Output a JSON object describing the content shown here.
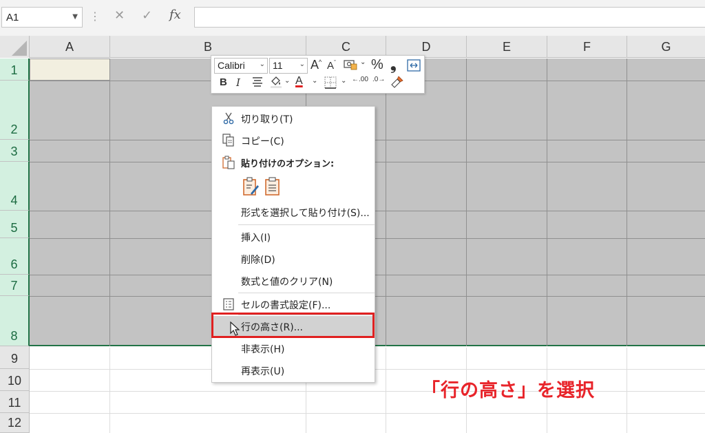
{
  "formula_bar": {
    "name_box": "A1",
    "cancel_icon": "✕",
    "enter_icon": "✓",
    "fx_label": "fx",
    "formula": ""
  },
  "columns": [
    "A",
    "B",
    "C",
    "D",
    "E",
    "F",
    "G"
  ],
  "rows": [
    "1",
    "2",
    "3",
    "4",
    "5",
    "6",
    "7",
    "8",
    "9",
    "10",
    "11",
    "12"
  ],
  "mini_toolbar": {
    "font_name": "Calibri",
    "font_size": "11",
    "increase_font": "A",
    "decrease_font": "A",
    "percent": "%",
    "comma": "❟",
    "bold": "B",
    "italic": "I",
    "font_color_label": "A",
    "increase_decimal": ".00",
    "decrease_decimal": ".0"
  },
  "context_menu": {
    "items": [
      {
        "label": "切り取り(T)",
        "icon": "scissors-icon"
      },
      {
        "label": "コピー(C)",
        "icon": "copy-icon"
      },
      {
        "label": "貼り付けのオプション:",
        "icon": "paste-icon"
      },
      {
        "label": "形式を選択して貼り付け(S)..."
      },
      {
        "label": "挿入(I)"
      },
      {
        "label": "削除(D)"
      },
      {
        "label": "数式と値のクリア(N)"
      },
      {
        "label": "セルの書式設定(F)...",
        "icon": "format-cells-icon"
      },
      {
        "label": "行の高さ(R)..."
      },
      {
        "label": "非表示(H)"
      },
      {
        "label": "再表示(U)"
      }
    ]
  },
  "annotation": "「行の高さ」を選択",
  "colors": {
    "accent_green": "#217346",
    "selection_gray": "#c3c3c3",
    "highlight_red": "#e02020"
  }
}
